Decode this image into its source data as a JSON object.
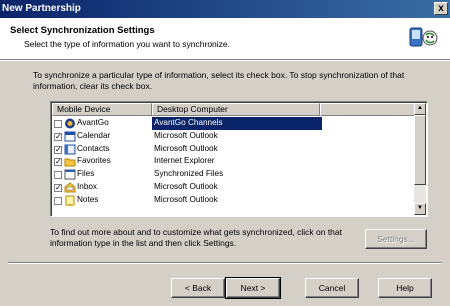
{
  "window": {
    "title": "New Partnership",
    "close_label": "x"
  },
  "header": {
    "title": "Select Synchronization Settings",
    "subtitle": "Select the type of information you want to synchronize.",
    "icon": "sync-wizard-icon"
  },
  "intro_text": "To synchronize a particular type of information, select its check box. To stop synchronization of that information, clear its check box.",
  "list": {
    "columns": [
      "Mobile Device",
      "Desktop Computer"
    ],
    "rows": [
      {
        "device": "AvantGo",
        "desktop": "AvantGo Channels",
        "checked": false,
        "selected": true,
        "icon": "avantgo-icon"
      },
      {
        "device": "Calendar",
        "desktop": "Microsoft Outlook",
        "checked": true,
        "selected": false,
        "icon": "calendar-icon"
      },
      {
        "device": "Contacts",
        "desktop": "Microsoft Outlook",
        "checked": true,
        "selected": false,
        "icon": "contacts-icon"
      },
      {
        "device": "Favorites",
        "desktop": "Internet Explorer",
        "checked": true,
        "selected": false,
        "icon": "favorites-folder-icon"
      },
      {
        "device": "Files",
        "desktop": "Synchronized Files",
        "checked": false,
        "selected": false,
        "icon": "files-icon"
      },
      {
        "device": "Inbox",
        "desktop": "Microsoft Outlook",
        "checked": true,
        "selected": false,
        "icon": "inbox-icon"
      },
      {
        "device": "Notes",
        "desktop": "Microsoft Outlook",
        "checked": false,
        "selected": false,
        "icon": "notes-icon"
      }
    ]
  },
  "info_text": "To find out more about and to customize what gets synchronized, click on that information type in the list and then click Settings.",
  "buttons": {
    "settings": "Settings...",
    "back": "< Back",
    "next": "Next >",
    "cancel": "Cancel",
    "help": "Help"
  },
  "colors": {
    "titlebar": "#0a246a",
    "selection": "#0a246a",
    "face": "#d4d0c8"
  }
}
